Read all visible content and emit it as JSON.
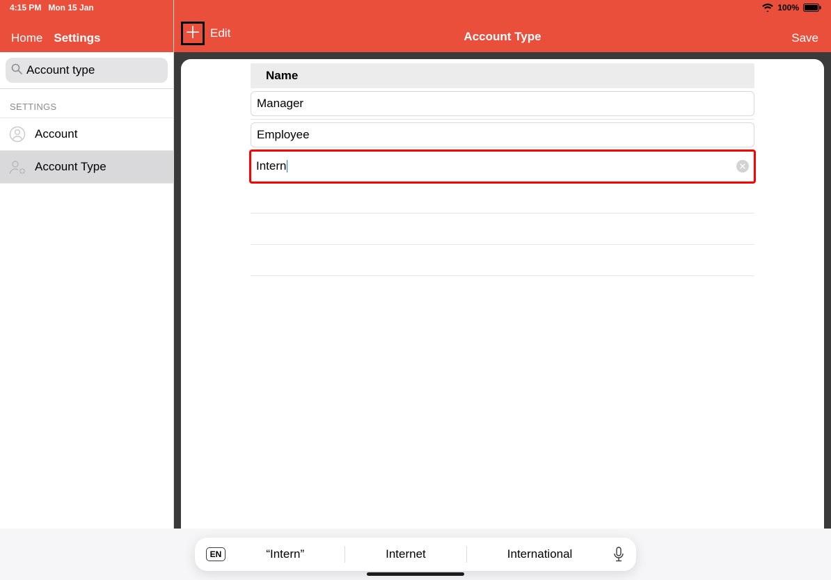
{
  "statusbar": {
    "time": "4:15 PM",
    "date": "Mon 15 Jan",
    "battery": "100%"
  },
  "sidebar": {
    "nav": {
      "home": "Home",
      "settings": "Settings"
    },
    "search": {
      "value": "Account type"
    },
    "section_label": "SETTINGS",
    "items": [
      {
        "label": "Account"
      },
      {
        "label": "Account Type"
      }
    ]
  },
  "main": {
    "edit_label": "Edit",
    "title": "Account Type",
    "save_label": "Save",
    "column_header": "Name",
    "rows": [
      {
        "value": "Manager"
      },
      {
        "value": "Employee"
      },
      {
        "value": "Intern"
      }
    ]
  },
  "keyboard": {
    "lang": "EN",
    "suggestions": [
      "“Intern”",
      "Internet",
      "International"
    ]
  }
}
